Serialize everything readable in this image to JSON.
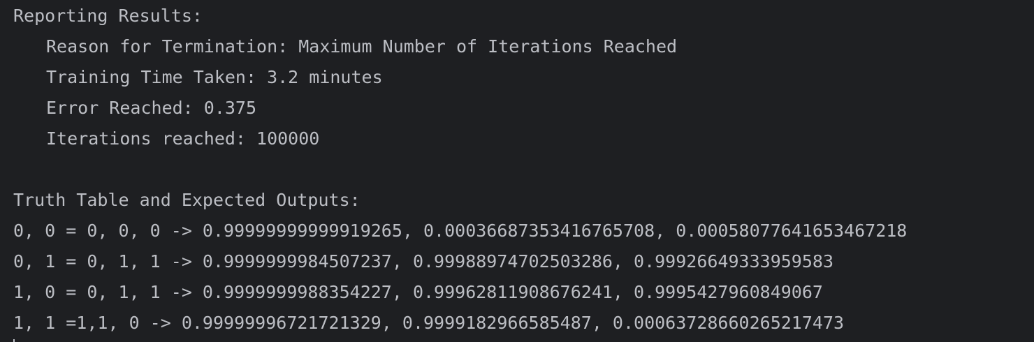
{
  "console": {
    "report_header": "Reporting Results:",
    "report_lines": [
      "Reason for Termination: Maximum Number of Iterations Reached",
      "Training Time Taken: 3.2 minutes",
      "Error Reached: 0.375",
      "Iterations reached: 100000"
    ],
    "table_header": "Truth Table and Expected Outputs:",
    "table_rows": [
      "0, 0 = 0, 0, 0 -> 0.99999999999919265, 0.00036687353416765708, 0.00058077641653467218",
      "0, 1 = 0, 1, 1 -> 0.9999999984507237, 0.99988974702503286, 0.9992664933395958З",
      "1, 0 = 0, 1, 1 -> 0.9999999988354227, 0.99962811908676241, 0.9995427960849067",
      "1, 1 = 1, 1, 0 -> 0.9999999672172132 9, 0.99991829665854 87, 0.000637286602652174 73"
    ]
  }
}
